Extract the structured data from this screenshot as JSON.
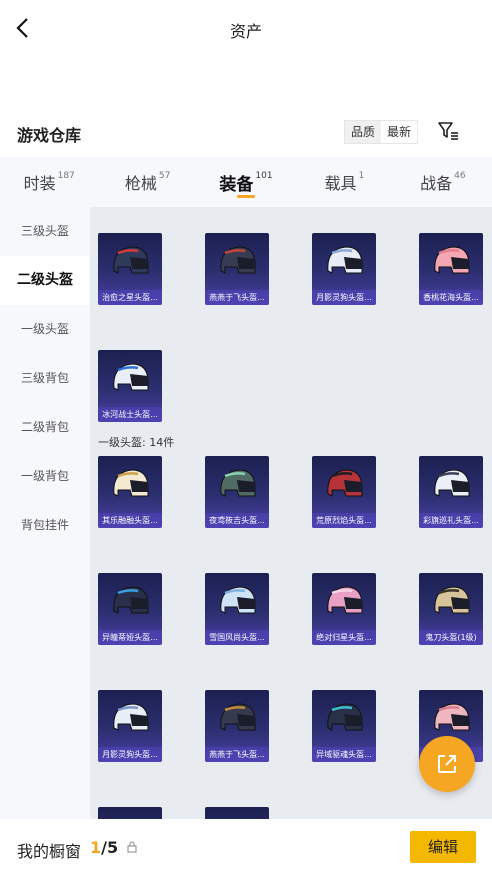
{
  "header": {
    "title": "资产"
  },
  "warehouse": {
    "title": "游戏仓库",
    "sort_options": [
      "品质",
      "最新"
    ],
    "active_sort_index": 1
  },
  "tabs": [
    {
      "label": "时装",
      "count": "187"
    },
    {
      "label": "枪械",
      "count": "57"
    },
    {
      "label": "装备",
      "count": "101",
      "active": true
    },
    {
      "label": "载具",
      "count": "1"
    },
    {
      "label": "战备",
      "count": "46"
    }
  ],
  "sidebar": {
    "items": [
      {
        "label": "三级头盔"
      },
      {
        "label": "二级头盔",
        "active": true
      },
      {
        "label": "一级头盔"
      },
      {
        "label": "三级背包"
      },
      {
        "label": "二级背包"
      },
      {
        "label": "一级背包"
      },
      {
        "label": "背包挂件"
      }
    ]
  },
  "section_label": "一级头盔: 14件",
  "items": [
    {
      "name": "治愈之星头盔...",
      "color": "#2e3a5a",
      "accent": "#d23b3b"
    },
    {
      "name": "燕燕于飞头盔...",
      "color": "#383c52",
      "accent": "#c2463a"
    },
    {
      "name": "月影灵狗头盔...",
      "color": "#e7ecf5",
      "accent": "#8aa7d8"
    },
    {
      "name": "香桃花海头盔...",
      "color": "#f2a7b2",
      "accent": "#e37d8f"
    },
    {
      "name": "冰河战士头盔...",
      "color": "#e9eef7",
      "accent": "#2a6fd4"
    },
    {
      "name": "其乐融融头盔...",
      "color": "#f4ead2",
      "accent": "#c9a14a"
    },
    {
      "name": "夜鸢筱吉头盔...",
      "color": "#4f6b63",
      "accent": "#8ad1b3"
    },
    {
      "name": "荒原烈焰头盔...",
      "color": "#b8323a",
      "accent": "#1e1e26"
    },
    {
      "name": "彩旗巡礼头盔...",
      "color": "#ecf0f6",
      "accent": "#3a3f55"
    },
    {
      "name": "异瞳蒂娅头盔...",
      "color": "#2a2f4a",
      "accent": "#3b9fe0"
    },
    {
      "name": "雪国风尚头盔...",
      "color": "#cfe3f6",
      "accent": "#7fb0de"
    },
    {
      "name": "绝对归星头盔...",
      "color": "#e9a0c3",
      "accent": "#f3d6e6"
    },
    {
      "name": "鬼刀头盔(1级)",
      "color": "#d8c49a",
      "accent": "#3b3428"
    },
    {
      "name": "月影灵狗头盔...",
      "color": "#e8eef8",
      "accent": "#7a96c8"
    },
    {
      "name": "燕燕于飞头盔...",
      "color": "#363a4e",
      "accent": "#c28b3a"
    },
    {
      "name": "异域驱魂头盔...",
      "color": "#2a3048",
      "accent": "#3ac0d0"
    },
    {
      "name": "",
      "color": "#f0b6bf",
      "accent": "#d77e8c"
    }
  ],
  "showcase": {
    "label": "我的橱窗",
    "current": "1",
    "total": "/5"
  },
  "edit_label": "编辑",
  "colors": {
    "accent": "#f5a623",
    "card_bg": "#2c2f70"
  }
}
